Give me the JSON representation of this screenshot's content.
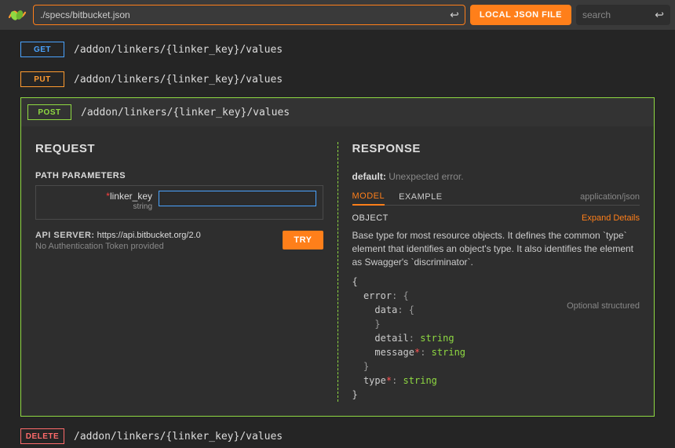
{
  "topbar": {
    "spec_path": "./specs/bitbucket.json",
    "local_button": "LOCAL JSON FILE",
    "search_placeholder": "search"
  },
  "endpoints": {
    "get": {
      "method": "GET",
      "path": "/addon/linkers/{linker_key}/values"
    },
    "put": {
      "method": "PUT",
      "path": "/addon/linkers/{linker_key}/values"
    },
    "post": {
      "method": "POST",
      "path": "/addon/linkers/{linker_key}/values"
    },
    "delete": {
      "method": "DELETE",
      "path": "/addon/linkers/{linker_key}/values"
    }
  },
  "request": {
    "title": "REQUEST",
    "path_params_label": "PATH PARAMETERS",
    "param_name": "linker_key",
    "param_type": "string",
    "api_server_label": "API SERVER:",
    "api_server_value": "https://api.bitbucket.org/2.0",
    "auth_note": "No Authentication Token provided",
    "try_label": "TRY"
  },
  "response": {
    "title": "RESPONSE",
    "default_label": "default:",
    "default_text": "Unexpected error.",
    "tab_model": "MODEL",
    "tab_example": "EXAMPLE",
    "content_type": "application/json",
    "object_label": "OBJECT",
    "expand_label": "Expand Details",
    "description": "Base type for most resource objects. It defines the common `type` element that identifies an object's type. It also identifies the element as Swagger's `discriminator`.",
    "opt_hint": "Optional structured",
    "schema": {
      "error": "error",
      "data": "data",
      "detail_key": "detail",
      "message_key": "message",
      "type_key": "type",
      "string_type": "string"
    }
  }
}
